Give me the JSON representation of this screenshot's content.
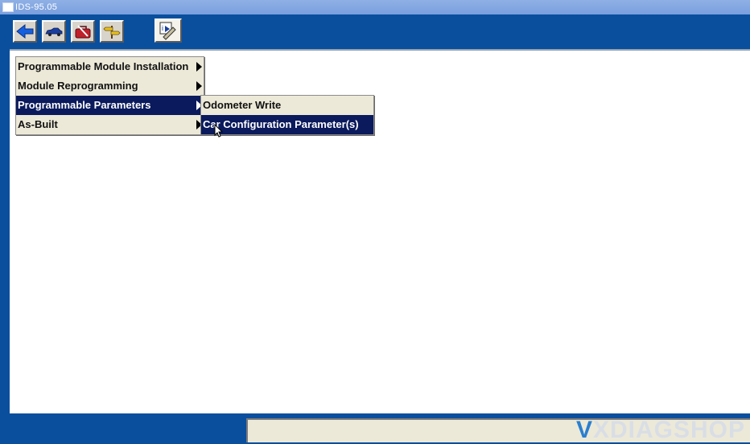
{
  "window": {
    "title": "IDS-95.05"
  },
  "toolbar": {
    "buttons": [
      {
        "icon": "back-arrow-icon"
      },
      {
        "icon": "vehicle-icon"
      },
      {
        "icon": "toolbox-icon"
      },
      {
        "icon": "signpost-icon"
      },
      {
        "icon": "module-programming-icon"
      }
    ]
  },
  "menu": {
    "items": [
      {
        "label": "Programmable Module Installation"
      },
      {
        "label": "Module Reprogramming"
      },
      {
        "label": "Programmable Parameters"
      },
      {
        "label": "As-Built"
      }
    ],
    "submenu": {
      "items": [
        {
          "label": "Odometer Write"
        },
        {
          "label": "Car Configuration Parameter(s)"
        }
      ]
    }
  },
  "watermark": {
    "first_letter": "V",
    "rest": "XDIAGSHOP"
  },
  "colors": {
    "background_blue": "#0a4f9e",
    "menu_bg": "#ece9d8",
    "selected_bg": "#0a1a5c"
  }
}
